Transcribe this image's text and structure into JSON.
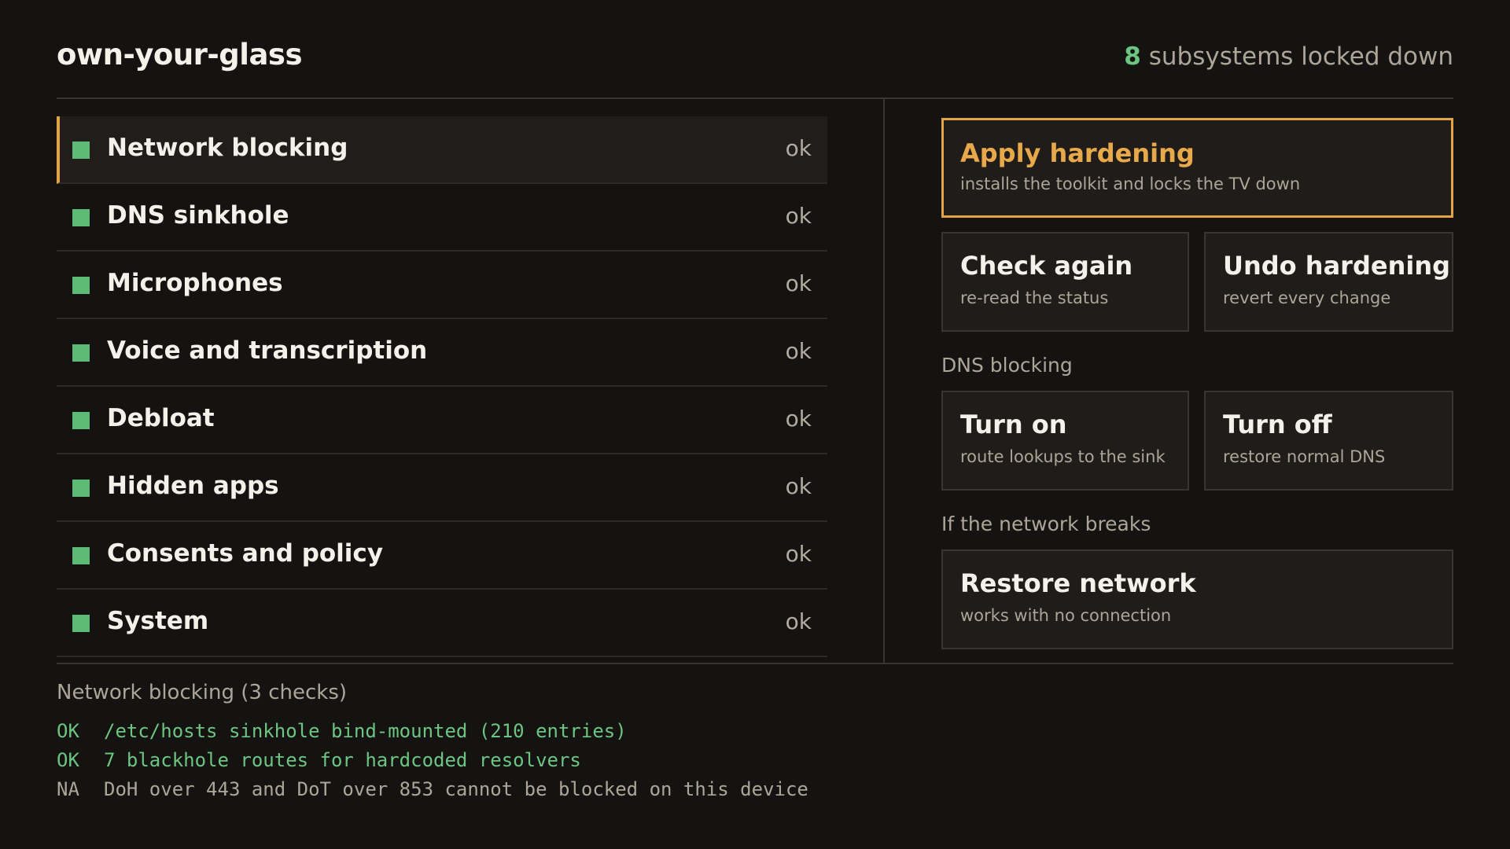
{
  "header": {
    "title": "own-your-glass",
    "summary_count": "8",
    "summary_text": "subsystems locked down"
  },
  "subsystems": [
    {
      "label": "Network blocking",
      "status": "ok",
      "selected": true
    },
    {
      "label": "DNS sinkhole",
      "status": "ok"
    },
    {
      "label": "Microphones",
      "status": "ok"
    },
    {
      "label": "Voice and transcription",
      "status": "ok"
    },
    {
      "label": "Debloat",
      "status": "ok"
    },
    {
      "label": "Hidden apps",
      "status": "ok"
    },
    {
      "label": "Consents and policy",
      "status": "ok"
    },
    {
      "label": "System",
      "status": "ok"
    }
  ],
  "actions": {
    "apply": {
      "title": "Apply hardening",
      "subtitle": "installs the toolkit and locks the TV down"
    },
    "check": {
      "title": "Check again",
      "subtitle": "re-read the status"
    },
    "undo": {
      "title": "Undo hardening",
      "subtitle": "revert every change"
    },
    "dns_section": "DNS blocking",
    "dns_on": {
      "title": "Turn on",
      "subtitle": "route lookups to the sink"
    },
    "dns_off": {
      "title": "Turn off",
      "subtitle": "restore normal DNS"
    },
    "network_section": "If the network breaks",
    "restore": {
      "title": "Restore network",
      "subtitle": "works with no connection"
    }
  },
  "detail": {
    "title": "Network blocking (3 checks)",
    "checks": [
      {
        "code": "OK",
        "text": "/etc/hosts sinkhole bind-mounted (210 entries)"
      },
      {
        "code": "OK",
        "text": "7 blackhole routes for hardcoded resolvers"
      },
      {
        "code": "NA",
        "text": "DoH over 443 and DoT over 853 cannot be blocked on this device"
      }
    ]
  },
  "colors": {
    "accent": "#e3a445",
    "ok_green": "#5dbb76",
    "background": "#151311"
  }
}
